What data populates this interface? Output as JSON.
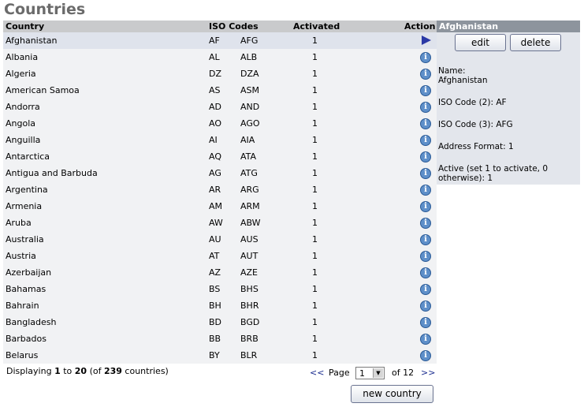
{
  "page": {
    "title": "Countries"
  },
  "table": {
    "headers": {
      "country": "Country",
      "iso": "ISO Codes",
      "activated": "Activated",
      "action": "Action"
    },
    "rows": [
      {
        "name": "Afghanistan",
        "iso2": "AF",
        "iso3": "AFG",
        "activated": "1",
        "action": "arrow"
      },
      {
        "name": "Albania",
        "iso2": "AL",
        "iso3": "ALB",
        "activated": "1",
        "action": "info"
      },
      {
        "name": "Algeria",
        "iso2": "DZ",
        "iso3": "DZA",
        "activated": "1",
        "action": "info"
      },
      {
        "name": "American Samoa",
        "iso2": "AS",
        "iso3": "ASM",
        "activated": "1",
        "action": "info"
      },
      {
        "name": "Andorra",
        "iso2": "AD",
        "iso3": "AND",
        "activated": "1",
        "action": "info"
      },
      {
        "name": "Angola",
        "iso2": "AO",
        "iso3": "AGO",
        "activated": "1",
        "action": "info"
      },
      {
        "name": "Anguilla",
        "iso2": "AI",
        "iso3": "AIA",
        "activated": "1",
        "action": "info"
      },
      {
        "name": "Antarctica",
        "iso2": "AQ",
        "iso3": "ATA",
        "activated": "1",
        "action": "info"
      },
      {
        "name": "Antigua and Barbuda",
        "iso2": "AG",
        "iso3": "ATG",
        "activated": "1",
        "action": "info"
      },
      {
        "name": "Argentina",
        "iso2": "AR",
        "iso3": "ARG",
        "activated": "1",
        "action": "info"
      },
      {
        "name": "Armenia",
        "iso2": "AM",
        "iso3": "ARM",
        "activated": "1",
        "action": "info"
      },
      {
        "name": "Aruba",
        "iso2": "AW",
        "iso3": "ABW",
        "activated": "1",
        "action": "info"
      },
      {
        "name": "Australia",
        "iso2": "AU",
        "iso3": "AUS",
        "activated": "1",
        "action": "info"
      },
      {
        "name": "Austria",
        "iso2": "AT",
        "iso3": "AUT",
        "activated": "1",
        "action": "info"
      },
      {
        "name": "Azerbaijan",
        "iso2": "AZ",
        "iso3": "AZE",
        "activated": "1",
        "action": "info"
      },
      {
        "name": "Bahamas",
        "iso2": "BS",
        "iso3": "BHS",
        "activated": "1",
        "action": "info"
      },
      {
        "name": "Bahrain",
        "iso2": "BH",
        "iso3": "BHR",
        "activated": "1",
        "action": "info"
      },
      {
        "name": "Bangladesh",
        "iso2": "BD",
        "iso3": "BGD",
        "activated": "1",
        "action": "info"
      },
      {
        "name": "Barbados",
        "iso2": "BB",
        "iso3": "BRB",
        "activated": "1",
        "action": "info"
      },
      {
        "name": "Belarus",
        "iso2": "BY",
        "iso3": "BLR",
        "activated": "1",
        "action": "info"
      }
    ],
    "selected_index": 0
  },
  "footer": {
    "displaying_prefix": "Displaying ",
    "from": "1",
    "to_word": " to ",
    "to": "20",
    "of_prefix": " (of ",
    "total": "239",
    "of_suffix": " countries)"
  },
  "pager": {
    "prev": "<<",
    "page_label": "Page",
    "page_value": "1",
    "of_label": "of 12",
    "next": ">>"
  },
  "buttons": {
    "new_country": "new country",
    "edit": "edit",
    "delete": "delete"
  },
  "side_panel": {
    "title": "Afghanistan",
    "name_label": "Name:",
    "name_value": "Afghanistan",
    "iso2_line": "ISO Code (2): AF",
    "iso3_line": "ISO Code (3): AFG",
    "address_line": "Address Format: 1",
    "active_line1": "Active (set 1 to activate, 0",
    "active_line2": "otherwise): 1"
  },
  "icons": {
    "info": "info-icon",
    "arrow": "arrow-right-icon"
  },
  "colors": {
    "accent": "#2b39a6",
    "header_bg": "#c9cacc",
    "panel_bg": "#e3e6ec",
    "panel_header": "#8d949d"
  }
}
